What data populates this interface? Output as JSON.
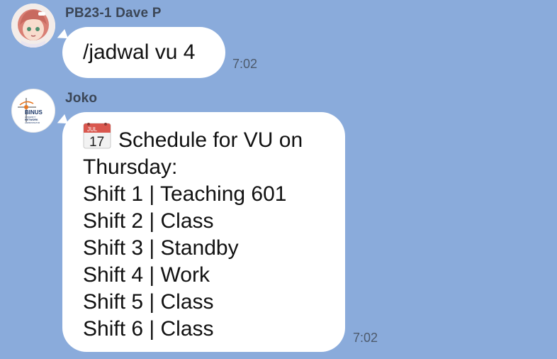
{
  "messages": [
    {
      "sender": "PB23-1 Dave P",
      "text": "/jadwal vu 4",
      "time": "7:02"
    },
    {
      "sender": "Joko",
      "avatar_logo": {
        "brand": "BINUS",
        "sub1": "UNIVERSITY",
        "sub2": "NETWORK",
        "sub3": "ADMINISTRATOR"
      },
      "calendar_icon": {
        "month": "JUL",
        "day": "17"
      },
      "lines": [
        "Schedule for VU on",
        "Thursday:",
        "Shift 1 | Teaching 601",
        "Shift 2 | Class",
        "Shift 3 | Standby",
        "Shift 4 | Work",
        "Shift 5 | Class",
        "Shift 6 | Class"
      ],
      "time": "7:02"
    }
  ],
  "colors": {
    "background": "#8aabdb",
    "bubble": "#ffffff",
    "sender_name": "#3b4656",
    "timestamp": "#4d5a6c"
  }
}
